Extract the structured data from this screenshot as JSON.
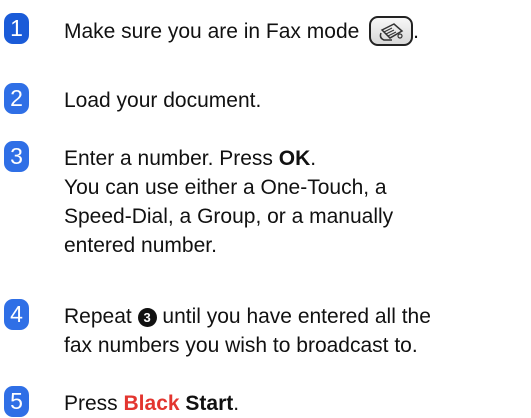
{
  "steps": [
    {
      "number": "1",
      "text_before_icon": "Make sure you are in Fax mode ",
      "text_after_icon": ".",
      "icon": "fax-mode-button-icon"
    },
    {
      "number": "2",
      "text": "Load your document."
    },
    {
      "number": "3",
      "line1_before_bold": "Enter a number. Press ",
      "line1_bold": "OK",
      "line1_after_bold": ".",
      "line2": "You can use either a One-Touch, a",
      "line3": "Speed-Dial, a Group, or a manually",
      "line4": "entered number."
    },
    {
      "number": "4",
      "line1_before_ref": "Repeat ",
      "line1_ref": "3",
      "line1_after_ref": " until you have entered all the",
      "line2": "fax numbers you wish to broadcast to."
    },
    {
      "number": "5",
      "text_before": "Press ",
      "text_red": "Black",
      "text_space": " ",
      "text_bold": "Start",
      "text_after": "."
    }
  ],
  "colors": {
    "badge_blue": "#1a5bd8",
    "badge_blue_light": "#2f6fe6",
    "highlight_red": "#e3352f"
  }
}
